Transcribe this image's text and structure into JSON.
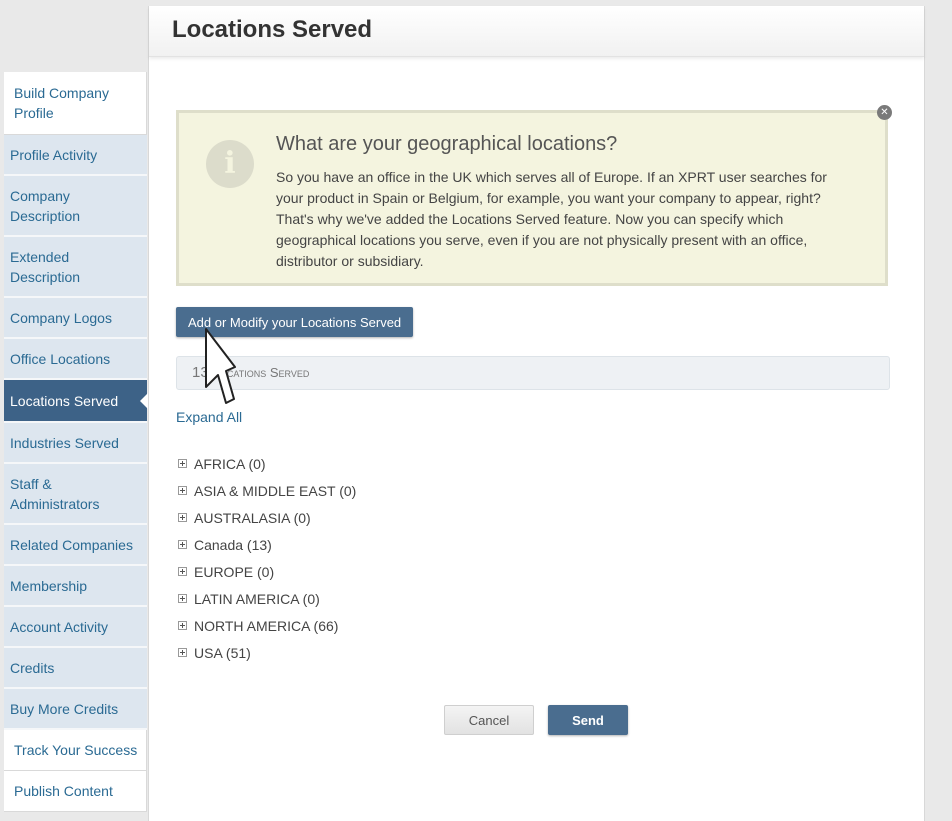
{
  "page_title": "Locations Served",
  "sidebar": {
    "items": [
      {
        "label": "Build Company Profile",
        "style": "white"
      },
      {
        "label": "Profile Activity",
        "style": "normal"
      },
      {
        "label": "Company Description",
        "style": "normal"
      },
      {
        "label": "Extended Description",
        "style": "normal"
      },
      {
        "label": "Company Logos",
        "style": "normal"
      },
      {
        "label": "Office Locations",
        "style": "normal"
      },
      {
        "label": "Locations Served",
        "style": "active"
      },
      {
        "label": "Industries Served",
        "style": "normal"
      },
      {
        "label": "Staff & Administrators",
        "style": "normal"
      },
      {
        "label": "Related Companies",
        "style": "normal"
      },
      {
        "label": "Membership",
        "style": "normal"
      },
      {
        "label": "Account Activity",
        "style": "normal"
      },
      {
        "label": "Credits",
        "style": "normal"
      },
      {
        "label": "Buy More Credits",
        "style": "normal"
      },
      {
        "label": "Track Your Success",
        "style": "white"
      },
      {
        "label": "Publish Content",
        "style": "white"
      }
    ]
  },
  "info_box": {
    "icon": "info-icon",
    "heading": "What are your geographical locations?",
    "text": "So you have an office in the UK which serves all of Europe. If an XPRT user searches for your product in Spain or Belgium, for example, you want your company to appear, right? That's why we've added the Locations Served feature. Now you can specify which geographical locations you serve, even if you are not physically present with an office, distributor or subsidiary.",
    "close_icon": "close-icon"
  },
  "modify_button": "Add or Modify your Locations Served",
  "locations_count": {
    "count": "13",
    "label": "Locations Served"
  },
  "expand_all": "Expand All",
  "tree": [
    {
      "label": "AFRICA (0)"
    },
    {
      "label": "ASIA & MIDDLE EAST (0)"
    },
    {
      "label": "AUSTRALASIA (0)"
    },
    {
      "label": "Canada (13)"
    },
    {
      "label": "EUROPE (0)"
    },
    {
      "label": "LATIN AMERICA (0)"
    },
    {
      "label": "NORTH AMERICA (66)"
    },
    {
      "label": "USA (51)"
    }
  ],
  "buttons": {
    "cancel": "Cancel",
    "send": "Send"
  },
  "colors": {
    "accent": "#4a6d8f",
    "active_nav": "#3d6287",
    "nav_bg": "#dde6ef",
    "link": "#2a6a93",
    "info_bg": "#f4f4df"
  }
}
